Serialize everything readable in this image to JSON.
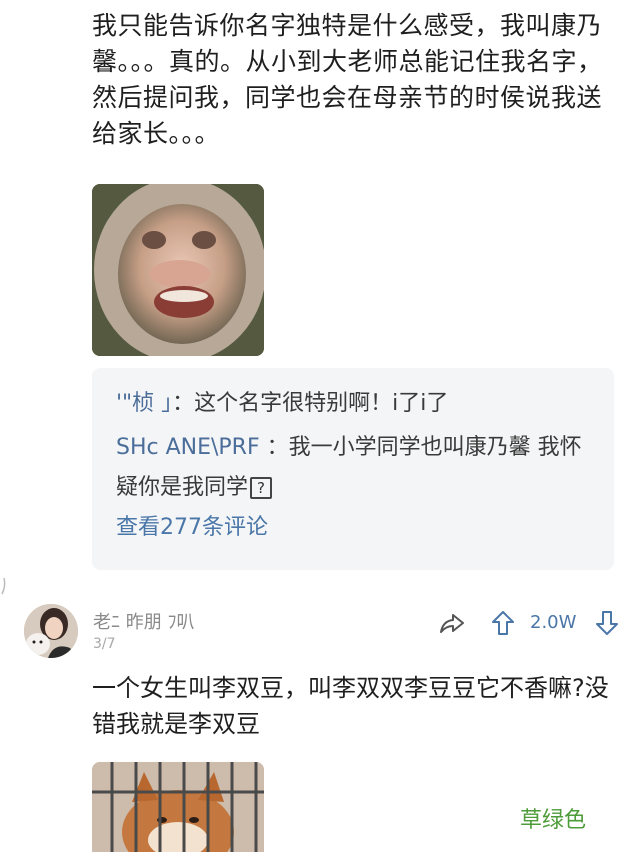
{
  "post": {
    "text": "我只能告诉你名字独特是什么感受，我叫康乃馨。。。真的。从小到大老师总能记住我名字，然后提问我，同学也会在母亲节的时侯说我送给家长。。。"
  },
  "replies": {
    "items": [
      {
        "nick": "'\"桢 」",
        "text": "：这个名字很特别啊！i了i了"
      },
      {
        "nick": "SHc ANE\\PRF ",
        "text": "：我一小学同学也叫康乃馨 我怀疑你是我同学"
      }
    ],
    "view_more": "查看277条评论"
  },
  "comment": {
    "username": "老ﾆ 昨朋 ﾌ叭",
    "date": "3/7",
    "upvotes": "2.0W",
    "text": "一个女生叫李双豆，叫李双双李豆豆它不香嘛?没错我就是李双豆"
  },
  "watermark": "草绿色",
  "colors": {
    "link_blue": "#4a76a8",
    "nick_blue": "#4b6d9a",
    "watermark_green": "#4e9b3a",
    "reply_bg": "#f4f5f7"
  },
  "icons": {
    "share": "share-arrow-icon",
    "upvote": "upvote-arrow-icon",
    "downvote": "downvote-arrow-icon",
    "unknown_char": "question-box-icon"
  }
}
